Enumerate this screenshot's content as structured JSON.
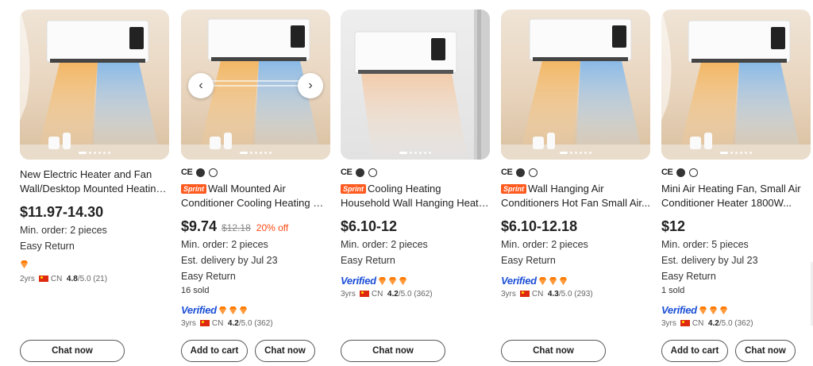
{
  "colors": {
    "accent": "#ff5a1f",
    "verified": "#1b4fd6",
    "diamond": "#ff7a00",
    "discount": "#ff4a14"
  },
  "products": [
    {
      "title_line1": "New Electric Heater and Fan",
      "title_line2": "Wall/Desktop Mounted Heating...",
      "price": "$11.97-14.30",
      "min_order": "Min. order: 2 pieces",
      "return": "Easy Return",
      "supplier_years": "2yrs",
      "supplier_country": "CN",
      "rating": "4.8",
      "rating_suffix": "/5.0 (21)",
      "chat_label": "Chat now"
    },
    {
      "certs": [
        "CE",
        "EMC",
        "LVD"
      ],
      "badge": "Sprint",
      "title_line1": "Wall Mounted Air",
      "title_line2": "Conditioner Cooling Heating Du...",
      "price": "$9.74",
      "old_price": "$12.18",
      "discount": "20% off",
      "min_order": "Min. order: 2 pieces",
      "delivery": "Est. delivery by Jul 23",
      "return": "Easy Return",
      "sold": "16 sold",
      "verified_label": "Verified",
      "supplier_years": "3yrs",
      "supplier_country": "CN",
      "rating": "4.2",
      "rating_suffix": "/5.0 (362)",
      "cart_label": "Add to cart",
      "chat_label": "Chat now",
      "prev_icon": "chevron-left-icon",
      "next_icon": "chevron-right-icon"
    },
    {
      "certs": [
        "CE",
        "EMC",
        "LVD"
      ],
      "badge": "Sprint",
      "title_line1": "Cooling Heating",
      "title_line2": "Household Wall Hanging Heate...",
      "price": "$6.10-12",
      "min_order": "Min. order: 2 pieces",
      "return": "Easy Return",
      "verified_label": "Verified",
      "supplier_years": "3yrs",
      "supplier_country": "CN",
      "rating": "4.2",
      "rating_suffix": "/5.0 (362)",
      "chat_label": "Chat now"
    },
    {
      "certs": [
        "CE",
        "EMC",
        "LVD"
      ],
      "badge": "Sprint",
      "title_line1": "Wall Hanging Air",
      "title_line2": "Conditioners Hot Fan Small Air...",
      "price": "$6.10-12.18",
      "min_order": "Min. order: 2 pieces",
      "return": "Easy Return",
      "verified_label": "Verified",
      "supplier_years": "3yrs",
      "supplier_country": "CN",
      "rating": "4.3",
      "rating_suffix": "/5.0 (293)",
      "chat_label": "Chat now"
    },
    {
      "certs": [
        "CE",
        "EMC",
        "LVD"
      ],
      "title_line1": "Mini Air Heating Fan, Small Air",
      "title_line2": "Conditioner Heater 1800W...",
      "price": "$12",
      "min_order": "Min. order: 5 pieces",
      "delivery": "Est. delivery by Jul 23",
      "return": "Easy Return",
      "sold": "1 sold",
      "verified_label": "Verified",
      "supplier_years": "3yrs",
      "supplier_country": "CN",
      "rating": "4.2",
      "rating_suffix": "/5.0 (362)",
      "cart_label": "Add to cart",
      "chat_label": "Chat now"
    }
  ]
}
